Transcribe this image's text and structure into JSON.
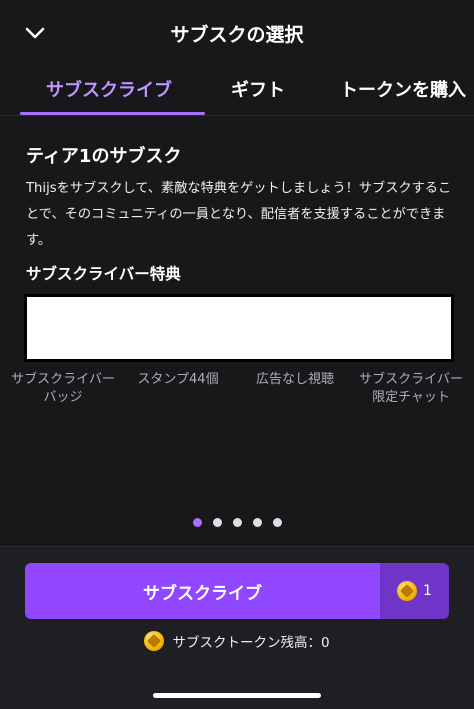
{
  "header": {
    "title": "サブスクの選択",
    "back_icon": "chevron-down-icon"
  },
  "tabs": [
    {
      "label": "サブスクライブ",
      "active": true
    },
    {
      "label": "ギフト",
      "active": false
    },
    {
      "label": "トークンを購入",
      "active": false
    }
  ],
  "tier": {
    "title": "ティア1のサブスク",
    "description": "Thijsをサブスクして、素敵な特典をゲットしましょう！サブスクすることで、そのコミュニティの一員となり、配信者を支援することができます。"
  },
  "benefits": {
    "title": "サブスクライバー特典",
    "items": [
      {
        "label": "サブスクライバーバッジ"
      },
      {
        "label": "スタンプ44個"
      },
      {
        "label": "広告なし視聴"
      },
      {
        "label": "サブスクライバー限定チャット"
      }
    ]
  },
  "pagination": {
    "count": 5,
    "active_index": 0
  },
  "footer": {
    "subscribe_label": "サブスクライブ",
    "token_price": "1",
    "balance_text": "サブスクトークン残高：0"
  },
  "colors": {
    "accent": "#9147ff",
    "accent_text": "#bf94ff",
    "background": "#18181b"
  }
}
